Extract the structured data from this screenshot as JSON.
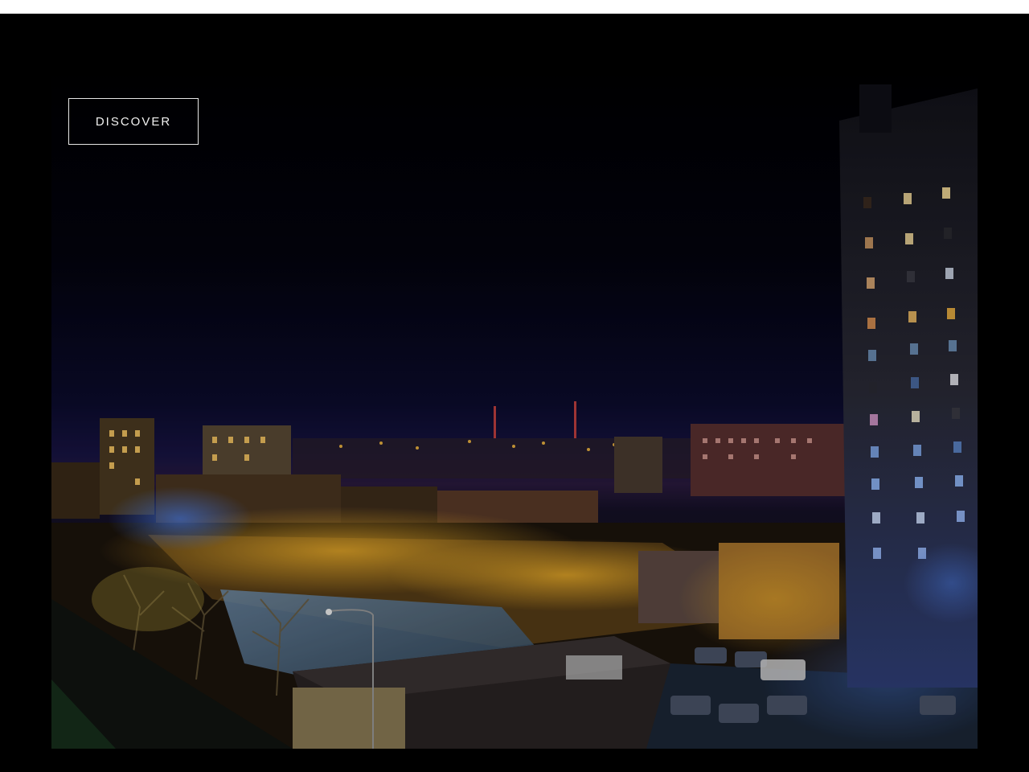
{
  "hero": {
    "cta_label": "DISCOVER",
    "image_subject": "night-city-skyline-photo"
  },
  "colors": {
    "page_background": "#000000",
    "cta_border": "#e6e6e6",
    "cta_text": "#f2f2f2",
    "street_light": "#e0a020",
    "night_sky": "#0a0a2a"
  }
}
